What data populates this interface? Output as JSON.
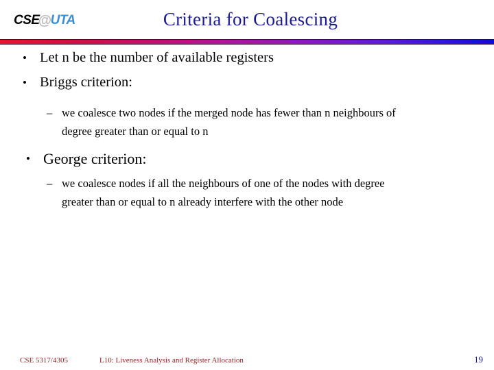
{
  "slide": {
    "title": "Criteria for Coalescing",
    "title_color": "#1b1b8f",
    "background_color": "#ffffff"
  },
  "logo": {
    "part1": "CSE",
    "at_symbol": "@",
    "part2": "UTA",
    "part1_color": "#000000",
    "at_color": "#b9b9b9",
    "part2_color": "#3b8fd4"
  },
  "divider": {
    "gradient_start_color": "#e8152a",
    "gradient_mid_color": "#b5119b",
    "gradient_end_color": "#1408d8"
  },
  "content": {
    "bullets": [
      {
        "marker": "•",
        "text": "Let n be the number of available registers"
      },
      {
        "marker": "•",
        "text": "Briggs criterion:"
      }
    ],
    "briggs_sub": {
      "marker": "–",
      "line1": "we coalesce two nodes if the merged node has fewer than n neighbours of",
      "line2": "degree greater than or equal to n"
    },
    "george_bullet": {
      "marker": "•",
      "text": "George criterion:"
    },
    "george_sub": {
      "marker": "–",
      "line1": "we coalesce nodes if all the neighbours of one of the nodes with degree",
      "line2": "greater than or equal to n already interfere with the other node"
    }
  },
  "footer": {
    "course": "CSE 5317/4305",
    "lecture": "L10: Liveness Analysis and Register Allocation",
    "page_number": "19",
    "text_color": "#8b2424",
    "page_color": "#1b1b8f"
  }
}
